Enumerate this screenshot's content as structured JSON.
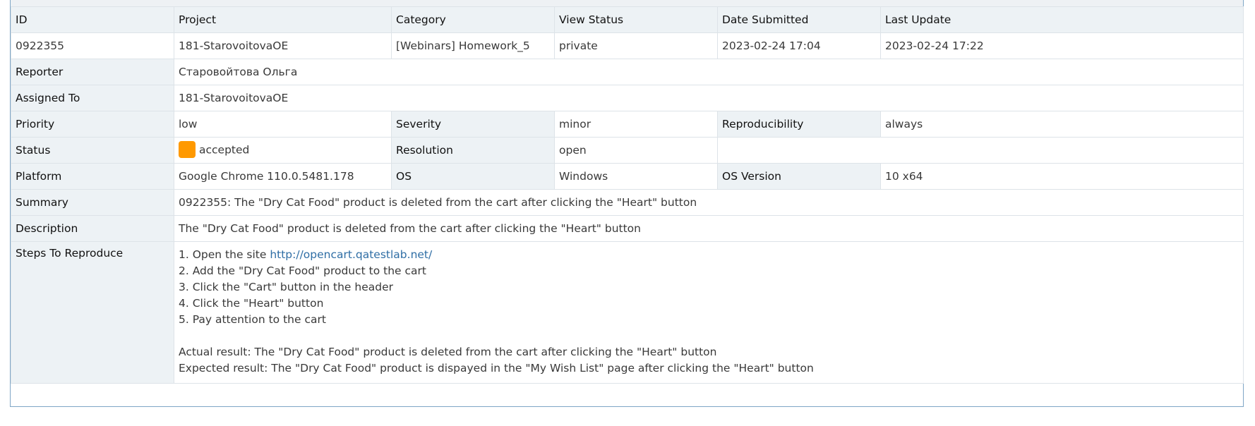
{
  "header": {
    "id": "ID",
    "project": "Project",
    "category": "Category",
    "view_status": "View Status",
    "date_submitted": "Date Submitted",
    "last_update": "Last Update"
  },
  "issue": {
    "id": "0922355",
    "project": "181-StarovoitovaOE",
    "category": "[Webinars] Homework_5",
    "view_status": "private",
    "date_submitted": "2023-02-24 17:04",
    "last_update": "2023-02-24 17:22"
  },
  "reporter": {
    "label": "Reporter",
    "value": "Старовойтова Ольга"
  },
  "assigned_to": {
    "label": "Assigned To",
    "value": "181-StarovoitovaOE"
  },
  "priority": {
    "label": "Priority",
    "value": "low"
  },
  "severity": {
    "label": "Severity",
    "value": "minor"
  },
  "reproducibility": {
    "label": "Reproducibility",
    "value": "always"
  },
  "status": {
    "label": "Status",
    "value": "accepted",
    "color": "#ff9900"
  },
  "resolution": {
    "label": "Resolution",
    "value": "open"
  },
  "platform": {
    "label": "Platform",
    "value": "Google Chrome 110.0.5481.178"
  },
  "os": {
    "label": "OS",
    "value": "Windows"
  },
  "os_version": {
    "label": "OS Version",
    "value": "10 x64"
  },
  "summary": {
    "label": "Summary",
    "value": "0922355: The \"Dry Cat Food\" product is deleted from the cart after clicking the \"Heart\" button"
  },
  "description": {
    "label": "Description",
    "value": "The \"Dry Cat Food\" product is deleted from the cart after clicking the \"Heart\" button"
  },
  "steps": {
    "label": "Steps To Reproduce",
    "step1_prefix": "1. Open the site ",
    "step1_link": "http://opencart.qatestlab.net/",
    "step2": "2. Add the \"Dry Cat Food\" product to the cart",
    "step3": "3. Click the \"Cart\" button in the header",
    "step4": "4. Click the \"Heart\" button",
    "step5": "5. Pay attention to the cart",
    "actual": "Actual result: The \"Dry Cat Food\" product is deleted from the cart after clicking the \"Heart\" button",
    "expected": "Expected result: The \"Dry Cat Food\" product is dispayed in the \"My Wish List\" page after clicking the \"Heart\" button"
  },
  "colors": {
    "accent": "#2f6ea5",
    "label_bg": "#edf2f5",
    "border": "#dde3e8"
  }
}
